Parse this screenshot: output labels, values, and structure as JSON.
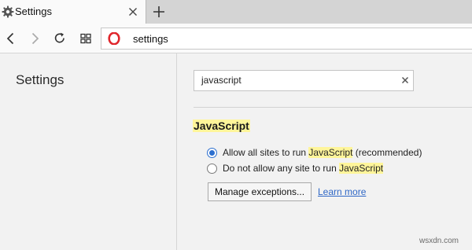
{
  "tab": {
    "title": "Settings",
    "icon": "gear-icon"
  },
  "toolbar": {
    "url": "settings",
    "icons": [
      "back-icon",
      "forward-icon",
      "reload-icon",
      "speed-dial-icon",
      "opera-logo-icon"
    ]
  },
  "sidebar": {
    "title": "Settings"
  },
  "search": {
    "value": "javascript"
  },
  "section": {
    "title": "JavaScript",
    "options": [
      {
        "prefix": "Allow all sites to run ",
        "highlight": "JavaScript",
        "suffix": " (recommended)",
        "selected": true
      },
      {
        "prefix": "Do not allow any site to run ",
        "highlight": "JavaScript",
        "suffix": "",
        "selected": false
      }
    ],
    "manage_label": "Manage exceptions...",
    "learn_more_label": "Learn more"
  },
  "watermark": "wsxdn.com",
  "colors": {
    "highlight": "#fff59a",
    "link": "#2f67c6",
    "radio_accent": "#2c6fcf",
    "opera_red": "#e0262c"
  }
}
